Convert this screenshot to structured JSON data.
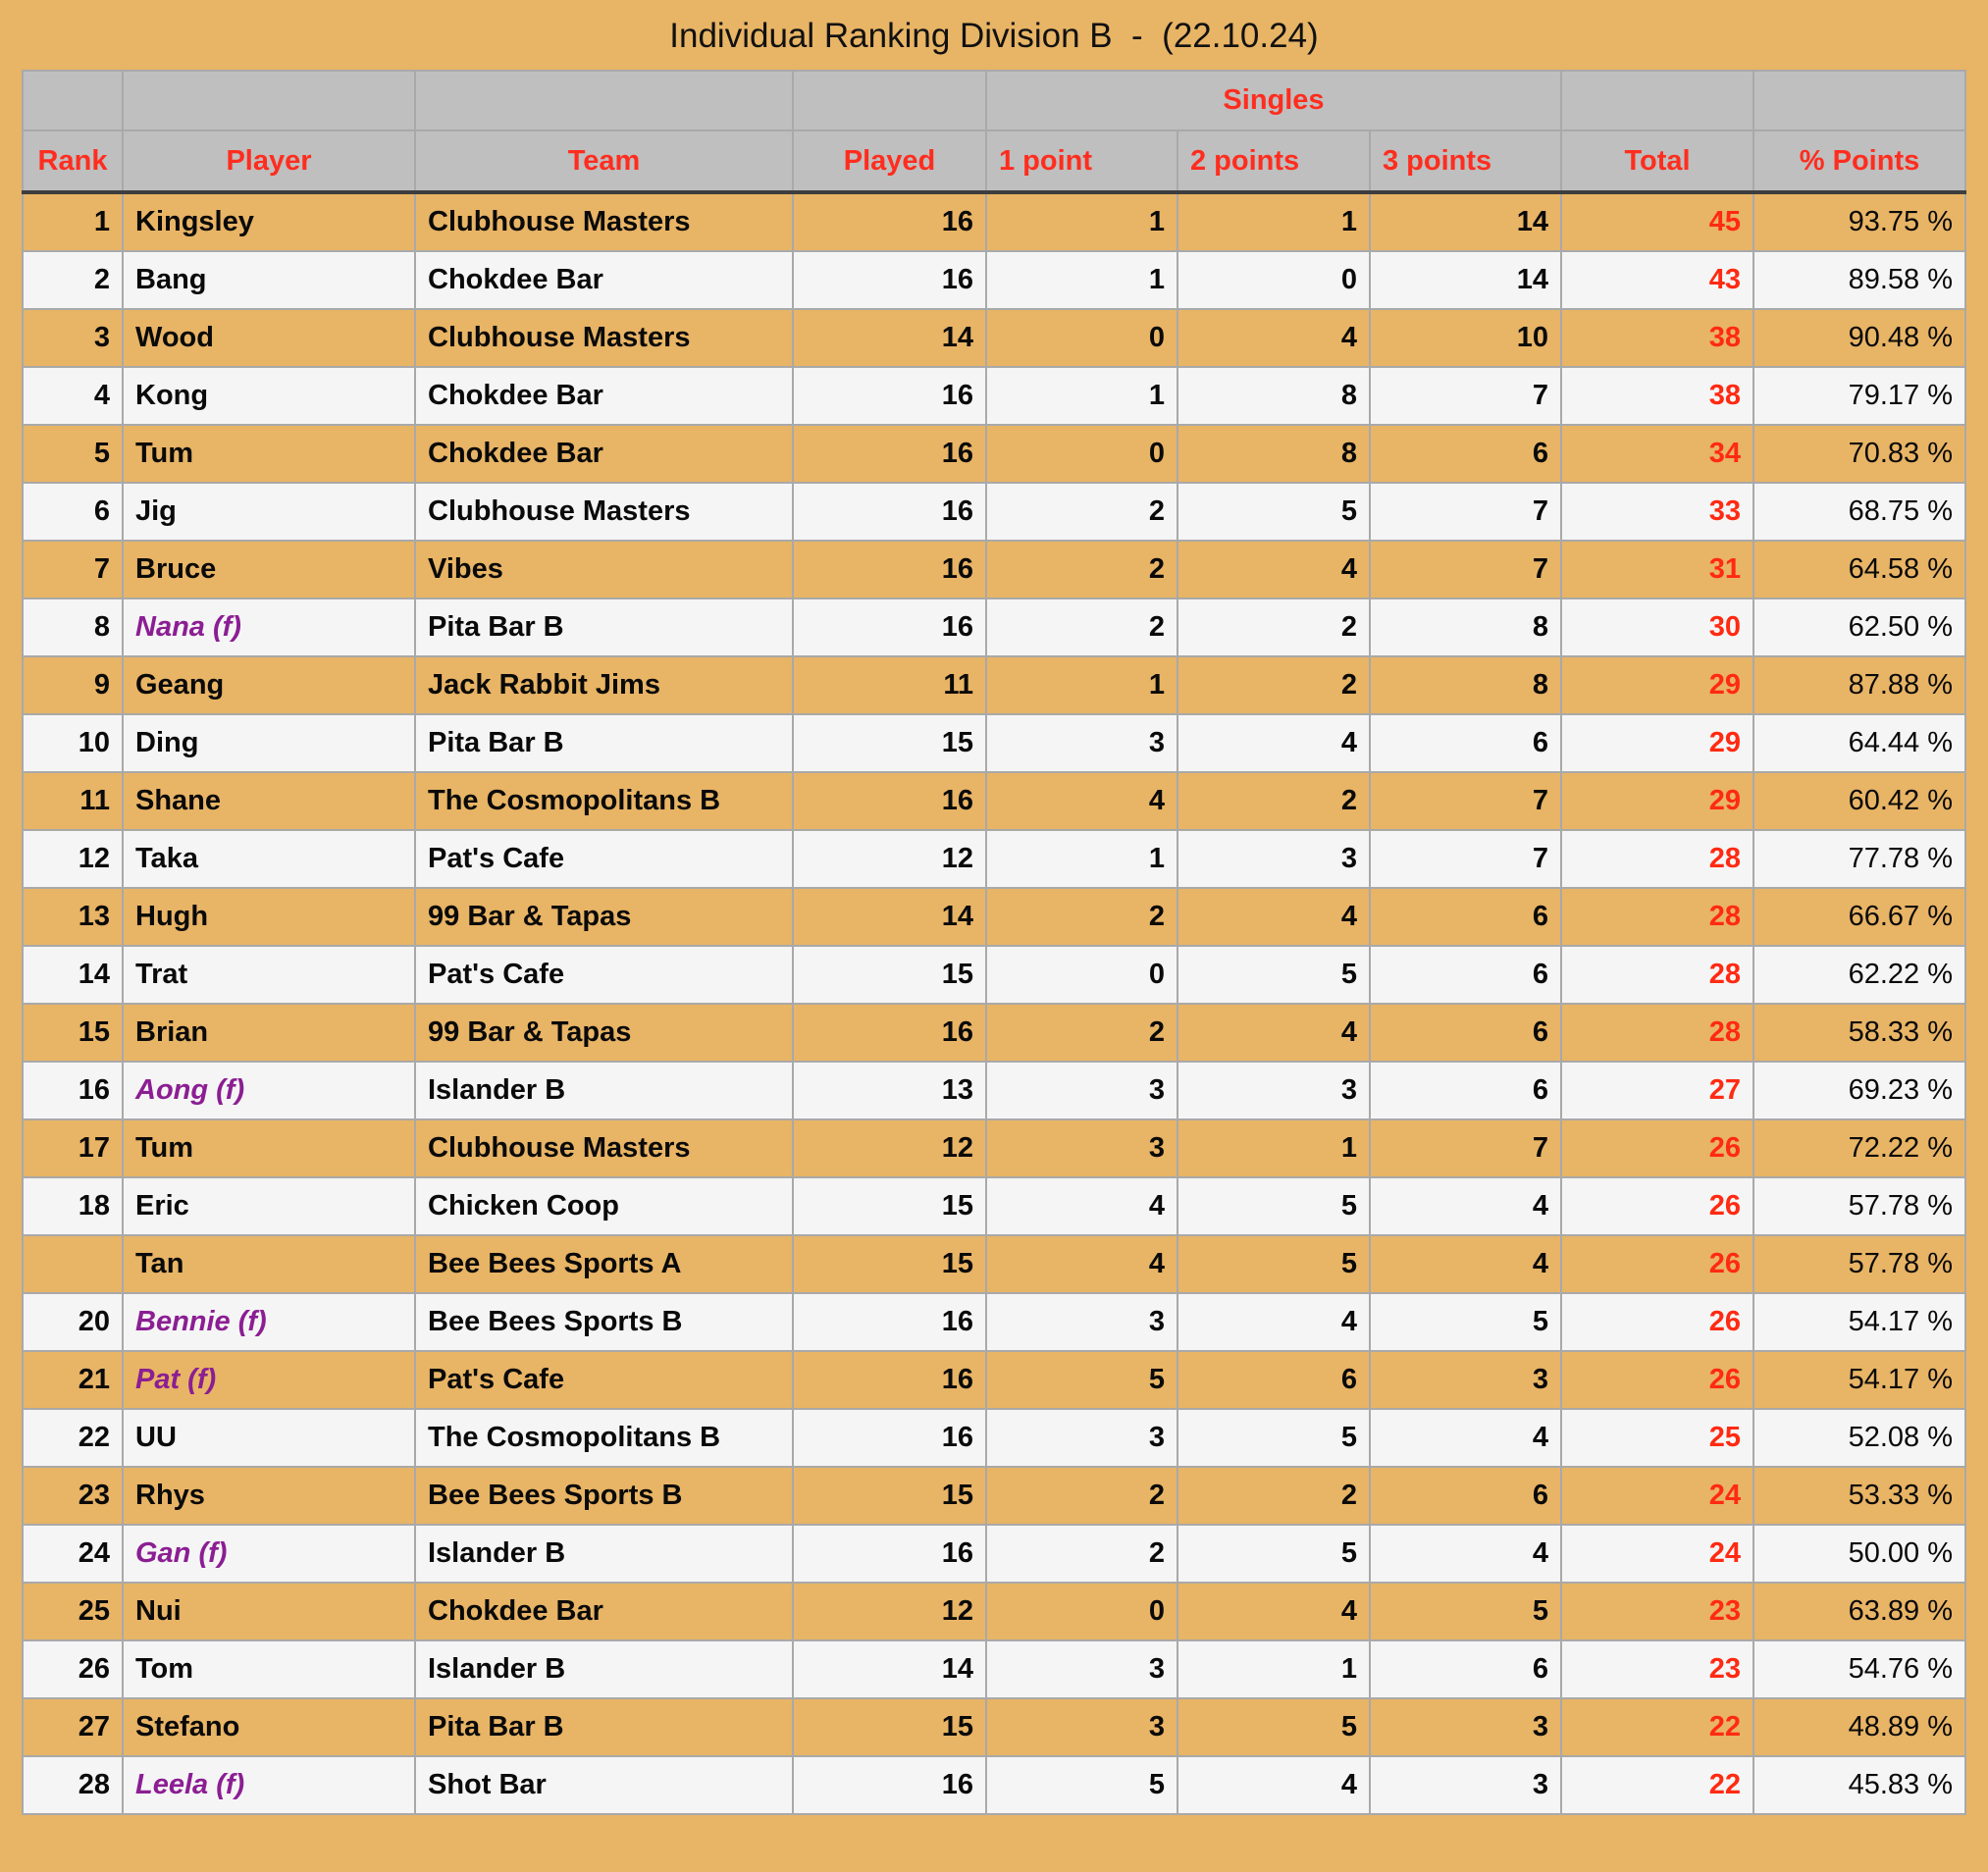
{
  "title": "Individual Ranking Division B  -  (22.10.24)",
  "colors": {
    "background": "#E8B465",
    "row_alt": "#F5F5F5",
    "header_bg": "#BEBFBE",
    "header_text": "#FF2D1F",
    "total_text": "#FF2A12",
    "female_player_text": "#8B1E93"
  },
  "header": {
    "group_label": "Singles",
    "columns": {
      "rank": "Rank",
      "player": "Player",
      "team": "Team",
      "played": "Played",
      "p1": "1 point",
      "p2": "2 points",
      "p3": "3 points",
      "total": "Total",
      "pct": "% Points"
    }
  },
  "rows": [
    {
      "rank": "1",
      "player": "Kingsley",
      "female": false,
      "team": "Clubhouse Masters",
      "played": "16",
      "p1": "1",
      "p2": "1",
      "p3": "14",
      "total": "45",
      "pct": "93.75 %"
    },
    {
      "rank": "2",
      "player": "Bang",
      "female": false,
      "team": "Chokdee Bar",
      "played": "16",
      "p1": "1",
      "p2": "0",
      "p3": "14",
      "total": "43",
      "pct": "89.58 %"
    },
    {
      "rank": "3",
      "player": "Wood",
      "female": false,
      "team": "Clubhouse Masters",
      "played": "14",
      "p1": "0",
      "p2": "4",
      "p3": "10",
      "total": "38",
      "pct": "90.48 %"
    },
    {
      "rank": "4",
      "player": "Kong",
      "female": false,
      "team": "Chokdee Bar",
      "played": "16",
      "p1": "1",
      "p2": "8",
      "p3": "7",
      "total": "38",
      "pct": "79.17 %"
    },
    {
      "rank": "5",
      "player": "Tum",
      "female": false,
      "team": "Chokdee Bar",
      "played": "16",
      "p1": "0",
      "p2": "8",
      "p3": "6",
      "total": "34",
      "pct": "70.83 %"
    },
    {
      "rank": "6",
      "player": "Jig",
      "female": false,
      "team": "Clubhouse Masters",
      "played": "16",
      "p1": "2",
      "p2": "5",
      "p3": "7",
      "total": "33",
      "pct": "68.75 %"
    },
    {
      "rank": "7",
      "player": "Bruce",
      "female": false,
      "team": "Vibes",
      "played": "16",
      "p1": "2",
      "p2": "4",
      "p3": "7",
      "total": "31",
      "pct": "64.58 %"
    },
    {
      "rank": "8",
      "player": "Nana (f)",
      "female": true,
      "team": "Pita Bar B",
      "played": "16",
      "p1": "2",
      "p2": "2",
      "p3": "8",
      "total": "30",
      "pct": "62.50 %"
    },
    {
      "rank": "9",
      "player": "Geang",
      "female": false,
      "team": "Jack Rabbit Jims",
      "played": "11",
      "p1": "1",
      "p2": "2",
      "p3": "8",
      "total": "29",
      "pct": "87.88 %"
    },
    {
      "rank": "10",
      "player": "Ding",
      "female": false,
      "team": "Pita Bar B",
      "played": "15",
      "p1": "3",
      "p2": "4",
      "p3": "6",
      "total": "29",
      "pct": "64.44 %"
    },
    {
      "rank": "11",
      "player": "Shane",
      "female": false,
      "team": "The Cosmopolitans B",
      "played": "16",
      "p1": "4",
      "p2": "2",
      "p3": "7",
      "total": "29",
      "pct": "60.42 %"
    },
    {
      "rank": "12",
      "player": "Taka",
      "female": false,
      "team": "Pat's Cafe",
      "played": "12",
      "p1": "1",
      "p2": "3",
      "p3": "7",
      "total": "28",
      "pct": "77.78 %"
    },
    {
      "rank": "13",
      "player": "Hugh",
      "female": false,
      "team": "99 Bar & Tapas",
      "played": "14",
      "p1": "2",
      "p2": "4",
      "p3": "6",
      "total": "28",
      "pct": "66.67 %"
    },
    {
      "rank": "14",
      "player": "Trat",
      "female": false,
      "team": "Pat's Cafe",
      "played": "15",
      "p1": "0",
      "p2": "5",
      "p3": "6",
      "total": "28",
      "pct": "62.22 %"
    },
    {
      "rank": "15",
      "player": "Brian",
      "female": false,
      "team": "99 Bar & Tapas",
      "played": "16",
      "p1": "2",
      "p2": "4",
      "p3": "6",
      "total": "28",
      "pct": "58.33 %"
    },
    {
      "rank": "16",
      "player": "Aong (f)",
      "female": true,
      "team": "Islander B",
      "played": "13",
      "p1": "3",
      "p2": "3",
      "p3": "6",
      "total": "27",
      "pct": "69.23 %"
    },
    {
      "rank": "17",
      "player": "Tum",
      "female": false,
      "team": "Clubhouse Masters",
      "played": "12",
      "p1": "3",
      "p2": "1",
      "p3": "7",
      "total": "26",
      "pct": "72.22 %"
    },
    {
      "rank": "18",
      "player": "Eric",
      "female": false,
      "team": "Chicken Coop",
      "played": "15",
      "p1": "4",
      "p2": "5",
      "p3": "4",
      "total": "26",
      "pct": "57.78 %"
    },
    {
      "rank": "",
      "player": "Tan",
      "female": false,
      "team": "Bee Bees Sports A",
      "played": "15",
      "p1": "4",
      "p2": "5",
      "p3": "4",
      "total": "26",
      "pct": "57.78 %"
    },
    {
      "rank": "20",
      "player": "Bennie (f)",
      "female": true,
      "team": "Bee Bees Sports B",
      "played": "16",
      "p1": "3",
      "p2": "4",
      "p3": "5",
      "total": "26",
      "pct": "54.17 %"
    },
    {
      "rank": "21",
      "player": "Pat (f)",
      "female": true,
      "team": "Pat's Cafe",
      "played": "16",
      "p1": "5",
      "p2": "6",
      "p3": "3",
      "total": "26",
      "pct": "54.17 %"
    },
    {
      "rank": "22",
      "player": "UU",
      "female": false,
      "team": "The Cosmopolitans B",
      "played": "16",
      "p1": "3",
      "p2": "5",
      "p3": "4",
      "total": "25",
      "pct": "52.08 %"
    },
    {
      "rank": "23",
      "player": "Rhys",
      "female": false,
      "team": "Bee Bees Sports B",
      "played": "15",
      "p1": "2",
      "p2": "2",
      "p3": "6",
      "total": "24",
      "pct": "53.33 %"
    },
    {
      "rank": "24",
      "player": "Gan (f)",
      "female": true,
      "team": "Islander B",
      "played": "16",
      "p1": "2",
      "p2": "5",
      "p3": "4",
      "total": "24",
      "pct": "50.00 %"
    },
    {
      "rank": "25",
      "player": "Nui",
      "female": false,
      "team": "Chokdee Bar",
      "played": "12",
      "p1": "0",
      "p2": "4",
      "p3": "5",
      "total": "23",
      "pct": "63.89 %"
    },
    {
      "rank": "26",
      "player": "Tom",
      "female": false,
      "team": "Islander B",
      "played": "14",
      "p1": "3",
      "p2": "1",
      "p3": "6",
      "total": "23",
      "pct": "54.76 %"
    },
    {
      "rank": "27",
      "player": "Stefano",
      "female": false,
      "team": "Pita Bar B",
      "played": "15",
      "p1": "3",
      "p2": "5",
      "p3": "3",
      "total": "22",
      "pct": "48.89 %"
    },
    {
      "rank": "28",
      "player": "Leela (f)",
      "female": true,
      "team": "Shot Bar",
      "played": "16",
      "p1": "5",
      "p2": "4",
      "p3": "3",
      "total": "22",
      "pct": "45.83 %"
    }
  ]
}
